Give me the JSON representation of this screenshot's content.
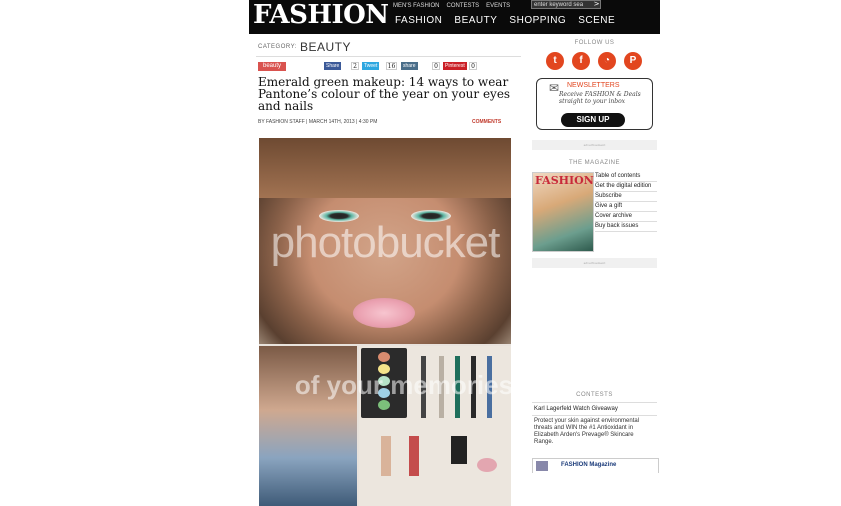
{
  "header": {
    "logo": "FASHION",
    "top_links": [
      "MEN'S FASHION",
      "CONTESTS",
      "EVENTS"
    ],
    "search_placeholder": "enter keyword sea",
    "search_go": ">",
    "main_nav": [
      "FASHION",
      "BEAUTY",
      "SHOPPING",
      "SCENE"
    ]
  },
  "article": {
    "category_label": "CATEGORY:",
    "category": "BEAUTY",
    "tag": "beauty",
    "shares": [
      {
        "label": "Share",
        "count": "2",
        "color": "#3b5998"
      },
      {
        "label": "Tweet",
        "count": "16",
        "color": "#2ea7e0"
      },
      {
        "label": "share",
        "count": "0",
        "color": "#4a6e8a"
      },
      {
        "label": "Pinterest",
        "count": "0",
        "color": "#cb2027"
      }
    ],
    "title": "Emerald green makeup: 14 ways to wear Pantone’s colour of the year on your eyes and nails",
    "byline": "BY FASHION STAFF | MARCH 14TH, 2013 | 4:30 PM",
    "comments": "COMMENTS",
    "watermark": "photobucket",
    "watermark_bottom": "of your memories"
  },
  "sidebar": {
    "follow_us": "FOLLOW US",
    "social": [
      {
        "name": "twitter",
        "glyph": "t"
      },
      {
        "name": "facebook",
        "glyph": "f"
      },
      {
        "name": "rss",
        "glyph": "◔"
      },
      {
        "name": "pinterest",
        "glyph": "P"
      }
    ],
    "newsletter_title": "NEWSLETTERS",
    "newsletter_sub": "Receive FASHION & Deals straight to your inbox",
    "signup": "SIGN UP",
    "ad_label": "advertisement",
    "magazine_header": "THE MAGAZINE",
    "cover_title": "FASHION",
    "magazine_links": [
      "Table of contents",
      "Get the digital edition",
      "Subscribe",
      "Give a gift",
      "Cover archive",
      "Buy back issues"
    ],
    "contests_header": "CONTESTS",
    "contest_title": "Karl Lagerfeld Watch Giveaway",
    "contest_text": "Protect your skin against environmental threats and WIN the #1 Antioxidant in Elizabeth Arden's Prevage® Skincare Range.",
    "fb_page": "FASHION Magazine"
  },
  "colors": {
    "accent": "#e2461f",
    "header_bg": "#0a0a0a",
    "tag_bg": "#d9534f"
  }
}
